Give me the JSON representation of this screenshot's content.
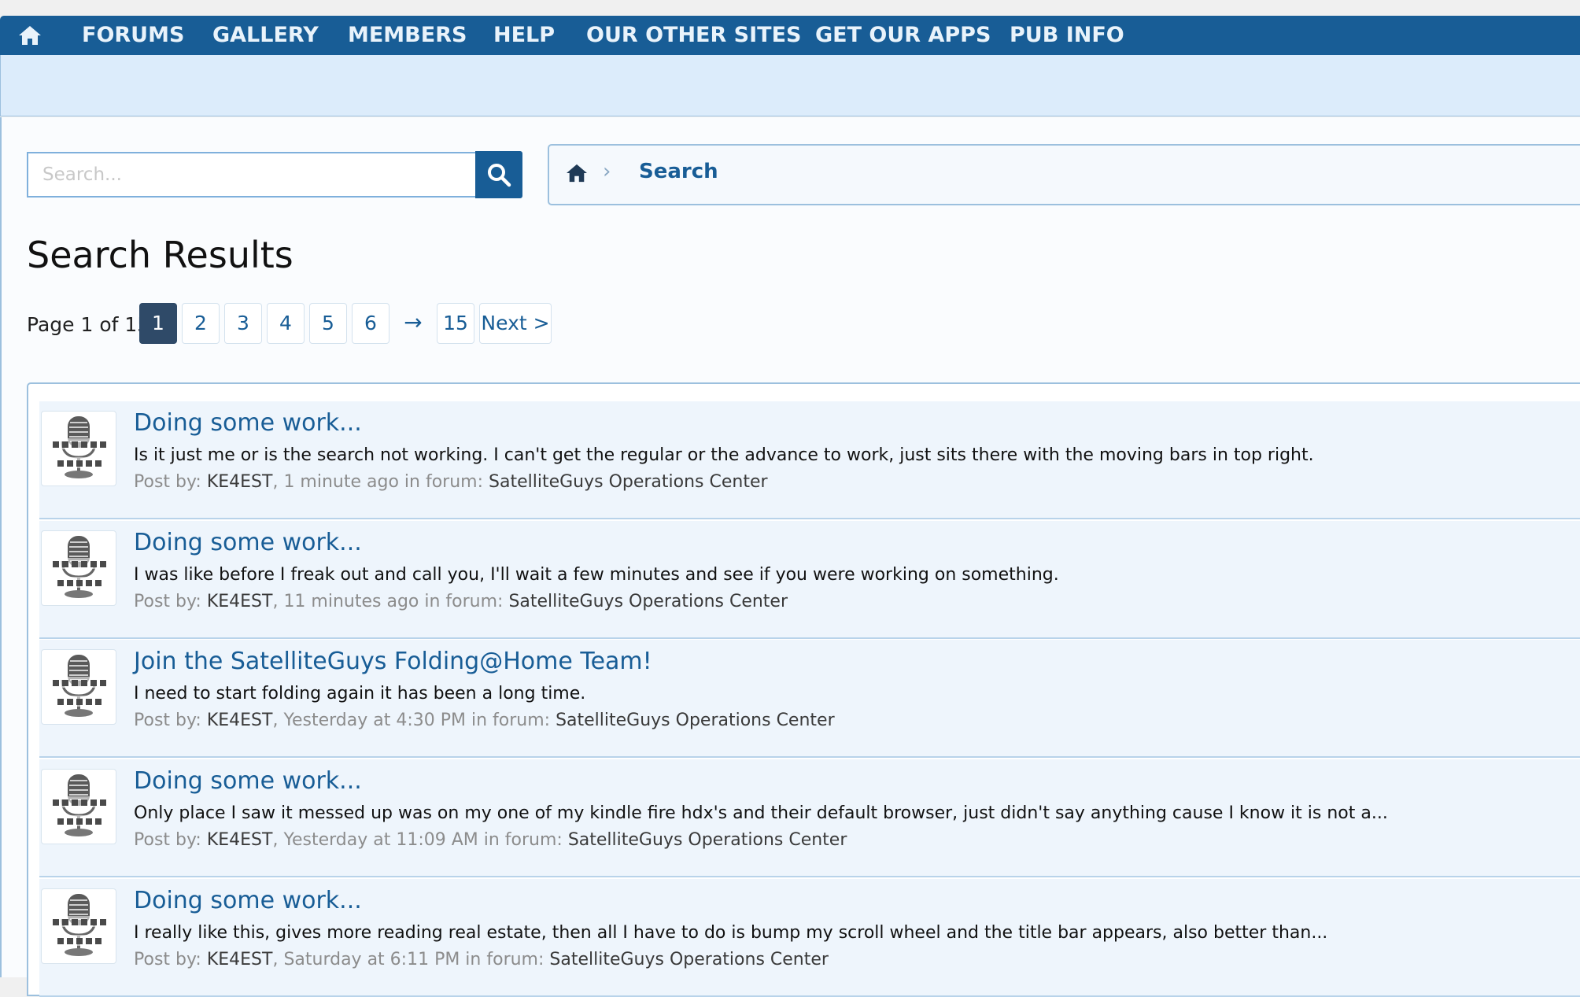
{
  "nav": {
    "home_icon": "home-icon",
    "items": [
      "FORUMS",
      "GALLERY",
      "MEMBERS",
      "HELP",
      "OUR OTHER SITES",
      "GET OUR APPS",
      "PUB INFO"
    ]
  },
  "search": {
    "placeholder": "Search...",
    "value": "",
    "button_icon": "search-icon"
  },
  "breadcrumb": {
    "home_icon": "home-icon",
    "separator": "›",
    "current": "Search"
  },
  "page": {
    "title": "Search Results"
  },
  "pagination": {
    "info": "Page 1 of 15",
    "pages": [
      "1",
      "2",
      "3",
      "4",
      "5",
      "6"
    ],
    "current": "1",
    "arrow": "→",
    "last": "15",
    "next": "Next >"
  },
  "results": [
    {
      "title": "Doing some work...",
      "snippet": "Is it just me or is the search not working. I can't get the regular or the advance to work, just sits there with the moving bars in top right.",
      "meta_prefix": "Post by: ",
      "author": "KE4EST",
      "time": ", 1 minute ago in forum: ",
      "forum": "SatelliteGuys Operations Center"
    },
    {
      "title": "Doing some work...",
      "snippet": "I was like before I freak out and call you, I'll wait a few minutes and see if you were working on something.",
      "meta_prefix": "Post by: ",
      "author": "KE4EST",
      "time": ", 11 minutes ago in forum: ",
      "forum": "SatelliteGuys Operations Center"
    },
    {
      "title": "Join the SatelliteGuys Folding@Home Team!",
      "snippet": "I need to start folding again it has been a long time.",
      "meta_prefix": "Post by: ",
      "author": "KE4EST",
      "time": ", Yesterday at 4:30 PM in forum: ",
      "forum": "SatelliteGuys Operations Center"
    },
    {
      "title": "Doing some work...",
      "snippet": "Only place I saw it messed up was on my one of my kindle fire hdx's and their default browser, just didn't say anything cause I know it is not a...",
      "meta_prefix": "Post by: ",
      "author": "KE4EST",
      "time": ", Yesterday at 11:09 AM in forum: ",
      "forum": "SatelliteGuys Operations Center"
    },
    {
      "title": "Doing some work...",
      "snippet": "I really like this, gives more reading real estate, then all I have to do is bump my scroll wheel and the title bar appears, also better than...",
      "meta_prefix": "Post by: ",
      "author": "KE4EST",
      "time": ", Saturday at 6:11 PM in forum: ",
      "forum": "SatelliteGuys Operations Center"
    }
  ],
  "colors": {
    "nav_bg": "#185d96",
    "subbar_bg": "#dcecfb",
    "link": "#185d96",
    "active_page": "#2f4a68"
  }
}
